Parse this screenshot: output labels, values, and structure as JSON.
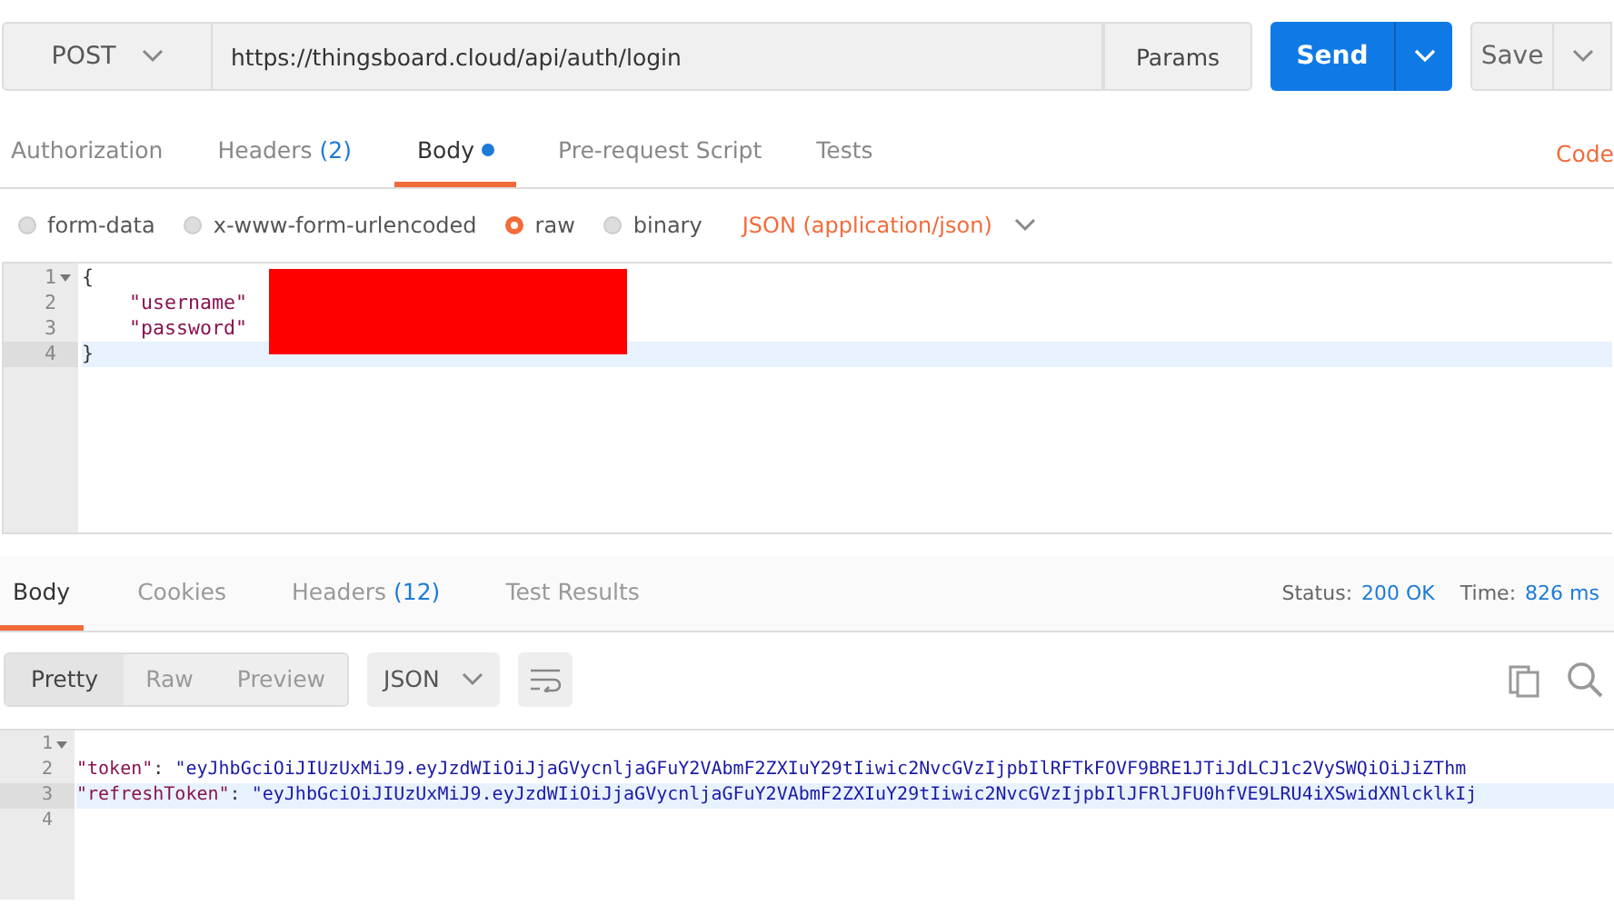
{
  "request": {
    "method": "POST",
    "url": "https://thingsboard.cloud/api/auth/login",
    "params": "Params",
    "send": "Send",
    "save": "Save"
  },
  "request_tabs": [
    {
      "label": "Authorization",
      "dot": false,
      "selected": false
    },
    {
      "label": "Headers",
      "count": "(2)",
      "dot": false,
      "selected": false
    },
    {
      "label": "Body",
      "dot": true,
      "selected": true
    },
    {
      "label": "Pre-request Script",
      "dot": false,
      "selected": false
    },
    {
      "label": "Tests",
      "dot": false,
      "selected": false
    }
  ],
  "code_link": "Code",
  "body_modes": [
    {
      "label": "form-data",
      "selected": false
    },
    {
      "label": "x-www-form-urlencoded",
      "selected": false
    },
    {
      "label": "raw",
      "selected": true
    },
    {
      "label": "binary",
      "selected": false
    }
  ],
  "body_format": "JSON (application/json)",
  "request_editor": {
    "redacted": true,
    "lines": [
      {
        "number": "1",
        "fold": true,
        "active": false,
        "tokens": [
          {
            "kind": "punct",
            "text": "{"
          }
        ]
      },
      {
        "number": "2",
        "fold": false,
        "active": false,
        "tokens": [
          {
            "kind": "indent"
          },
          {
            "kind": "key",
            "text": "\"username\""
          }
        ]
      },
      {
        "number": "3",
        "fold": false,
        "active": false,
        "tokens": [
          {
            "kind": "indent"
          },
          {
            "kind": "key",
            "text": "\"password\""
          }
        ]
      },
      {
        "number": "4",
        "fold": false,
        "active": true,
        "tokens": [
          {
            "kind": "punct",
            "text": "}"
          }
        ]
      }
    ]
  },
  "response_tabs": [
    {
      "label": "Body",
      "selected": true
    },
    {
      "label": "Cookies",
      "selected": false
    },
    {
      "label": "Headers",
      "count": "(12)",
      "selected": false
    },
    {
      "label": "Test Results",
      "selected": false
    }
  ],
  "status": {
    "label": "Status:",
    "value": "200 OK"
  },
  "time": {
    "label": "Time:",
    "value": "826 ms"
  },
  "view_modes": [
    {
      "label": "Pretty",
      "selected": true
    },
    {
      "label": "Raw",
      "selected": false
    },
    {
      "label": "Preview",
      "selected": false
    }
  ],
  "response_format": "JSON",
  "response_editor": {
    "lines": [
      {
        "number": "1",
        "fold": true,
        "active": false
      },
      {
        "number": "2",
        "fold": false,
        "active": false,
        "tokens": [
          {
            "kind": "key",
            "text": "\"token\""
          },
          {
            "kind": "punct",
            "text": ": "
          },
          {
            "kind": "string",
            "text": "\"eyJhbGciOiJIUzUxMiJ9.eyJzdWIiOiJjaGVycnljaGFuY2VAbmF2ZXIuY29tIiwic2NvcGVzIjpbIlRFTkFOVF9BRE1JTiJdLCJ1c2VySWQiOiJiZThm"
          }
        ]
      },
      {
        "number": "3",
        "fold": false,
        "active": true,
        "tokens": [
          {
            "kind": "key",
            "text": "\"refreshToken\""
          },
          {
            "kind": "punct",
            "text": ": "
          },
          {
            "kind": "string",
            "text": "\"eyJhbGciOiJIUzUxMiJ9.eyJzdWIiOiJjaGVycnljaGFuY2VAbmF2ZXIuY29tIiwic2NvcGVzIjpbIlJFRlJFU0hfVE9LRU4iXSwidXNlcklkIj"
          }
        ]
      },
      {
        "number": "4",
        "fold": false,
        "active": false
      }
    ]
  }
}
